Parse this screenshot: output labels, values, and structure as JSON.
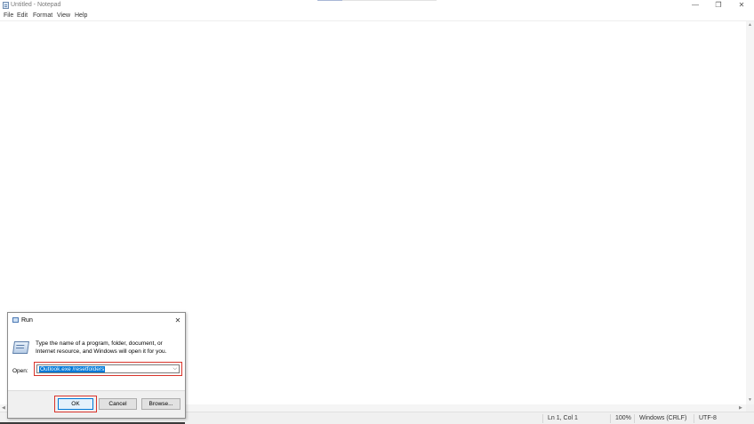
{
  "window": {
    "title": "Untitled - Notepad",
    "minimize_glyph": "—",
    "restore_glyph": "❐",
    "close_glyph": "✕"
  },
  "menu": {
    "items": [
      "File",
      "Edit",
      "Format",
      "View",
      "Help"
    ]
  },
  "statusbar": {
    "position": "Ln 1, Col 1",
    "zoom": "100%",
    "line_endings": "Windows (CRLF)",
    "encoding": "UTF-8"
  },
  "run_dialog": {
    "title": "Run",
    "close_glyph": "✕",
    "description": "Type the name of a program, folder, document, or Internet resource, and Windows will open it for you.",
    "open_label": "Open:",
    "open_value": "Outlook.exe /resetfolders",
    "ok_label": "OK",
    "cancel_label": "Cancel",
    "browse_label": "Browse...",
    "highlight_color": "#d9342b",
    "selection_color": "#0078d7"
  }
}
